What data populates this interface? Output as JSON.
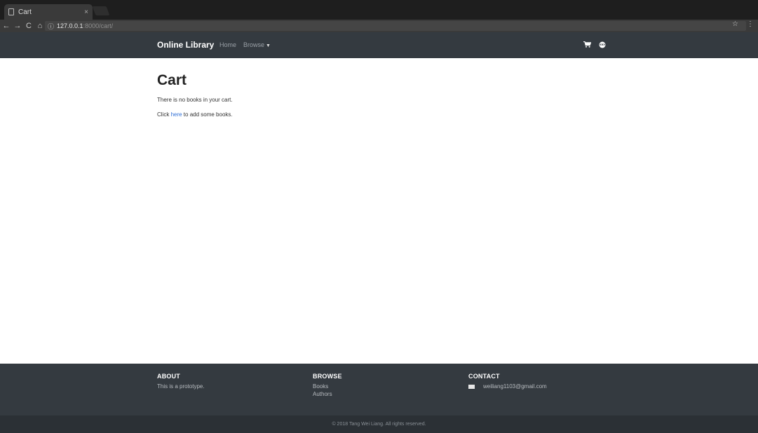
{
  "browser": {
    "tab_title": "Cart",
    "tab_close": "×",
    "url_host": "127.0.0.1",
    "url_path": ":8000/cart/"
  },
  "nav": {
    "brand": "Online Library",
    "home": "Home",
    "browse": "Browse"
  },
  "main": {
    "title": "Cart",
    "empty_message": "There is no books in your cart.",
    "prompt_before": "Click ",
    "prompt_link": "here",
    "prompt_after": " to add some books."
  },
  "footer": {
    "about_heading": "ABOUT",
    "about_text": "This is a prototype.",
    "browse_heading": "BROWSE",
    "browse_links": [
      "Books",
      "Authors"
    ],
    "contact_heading": "CONTACT",
    "contact_email": "weiliang1103@gmail.com",
    "copyright": "© 2018 Tang Wei Liang. All rights reserved."
  },
  "colors": {
    "navbar_bg": "#343a40",
    "link": "#2f6fd6"
  }
}
